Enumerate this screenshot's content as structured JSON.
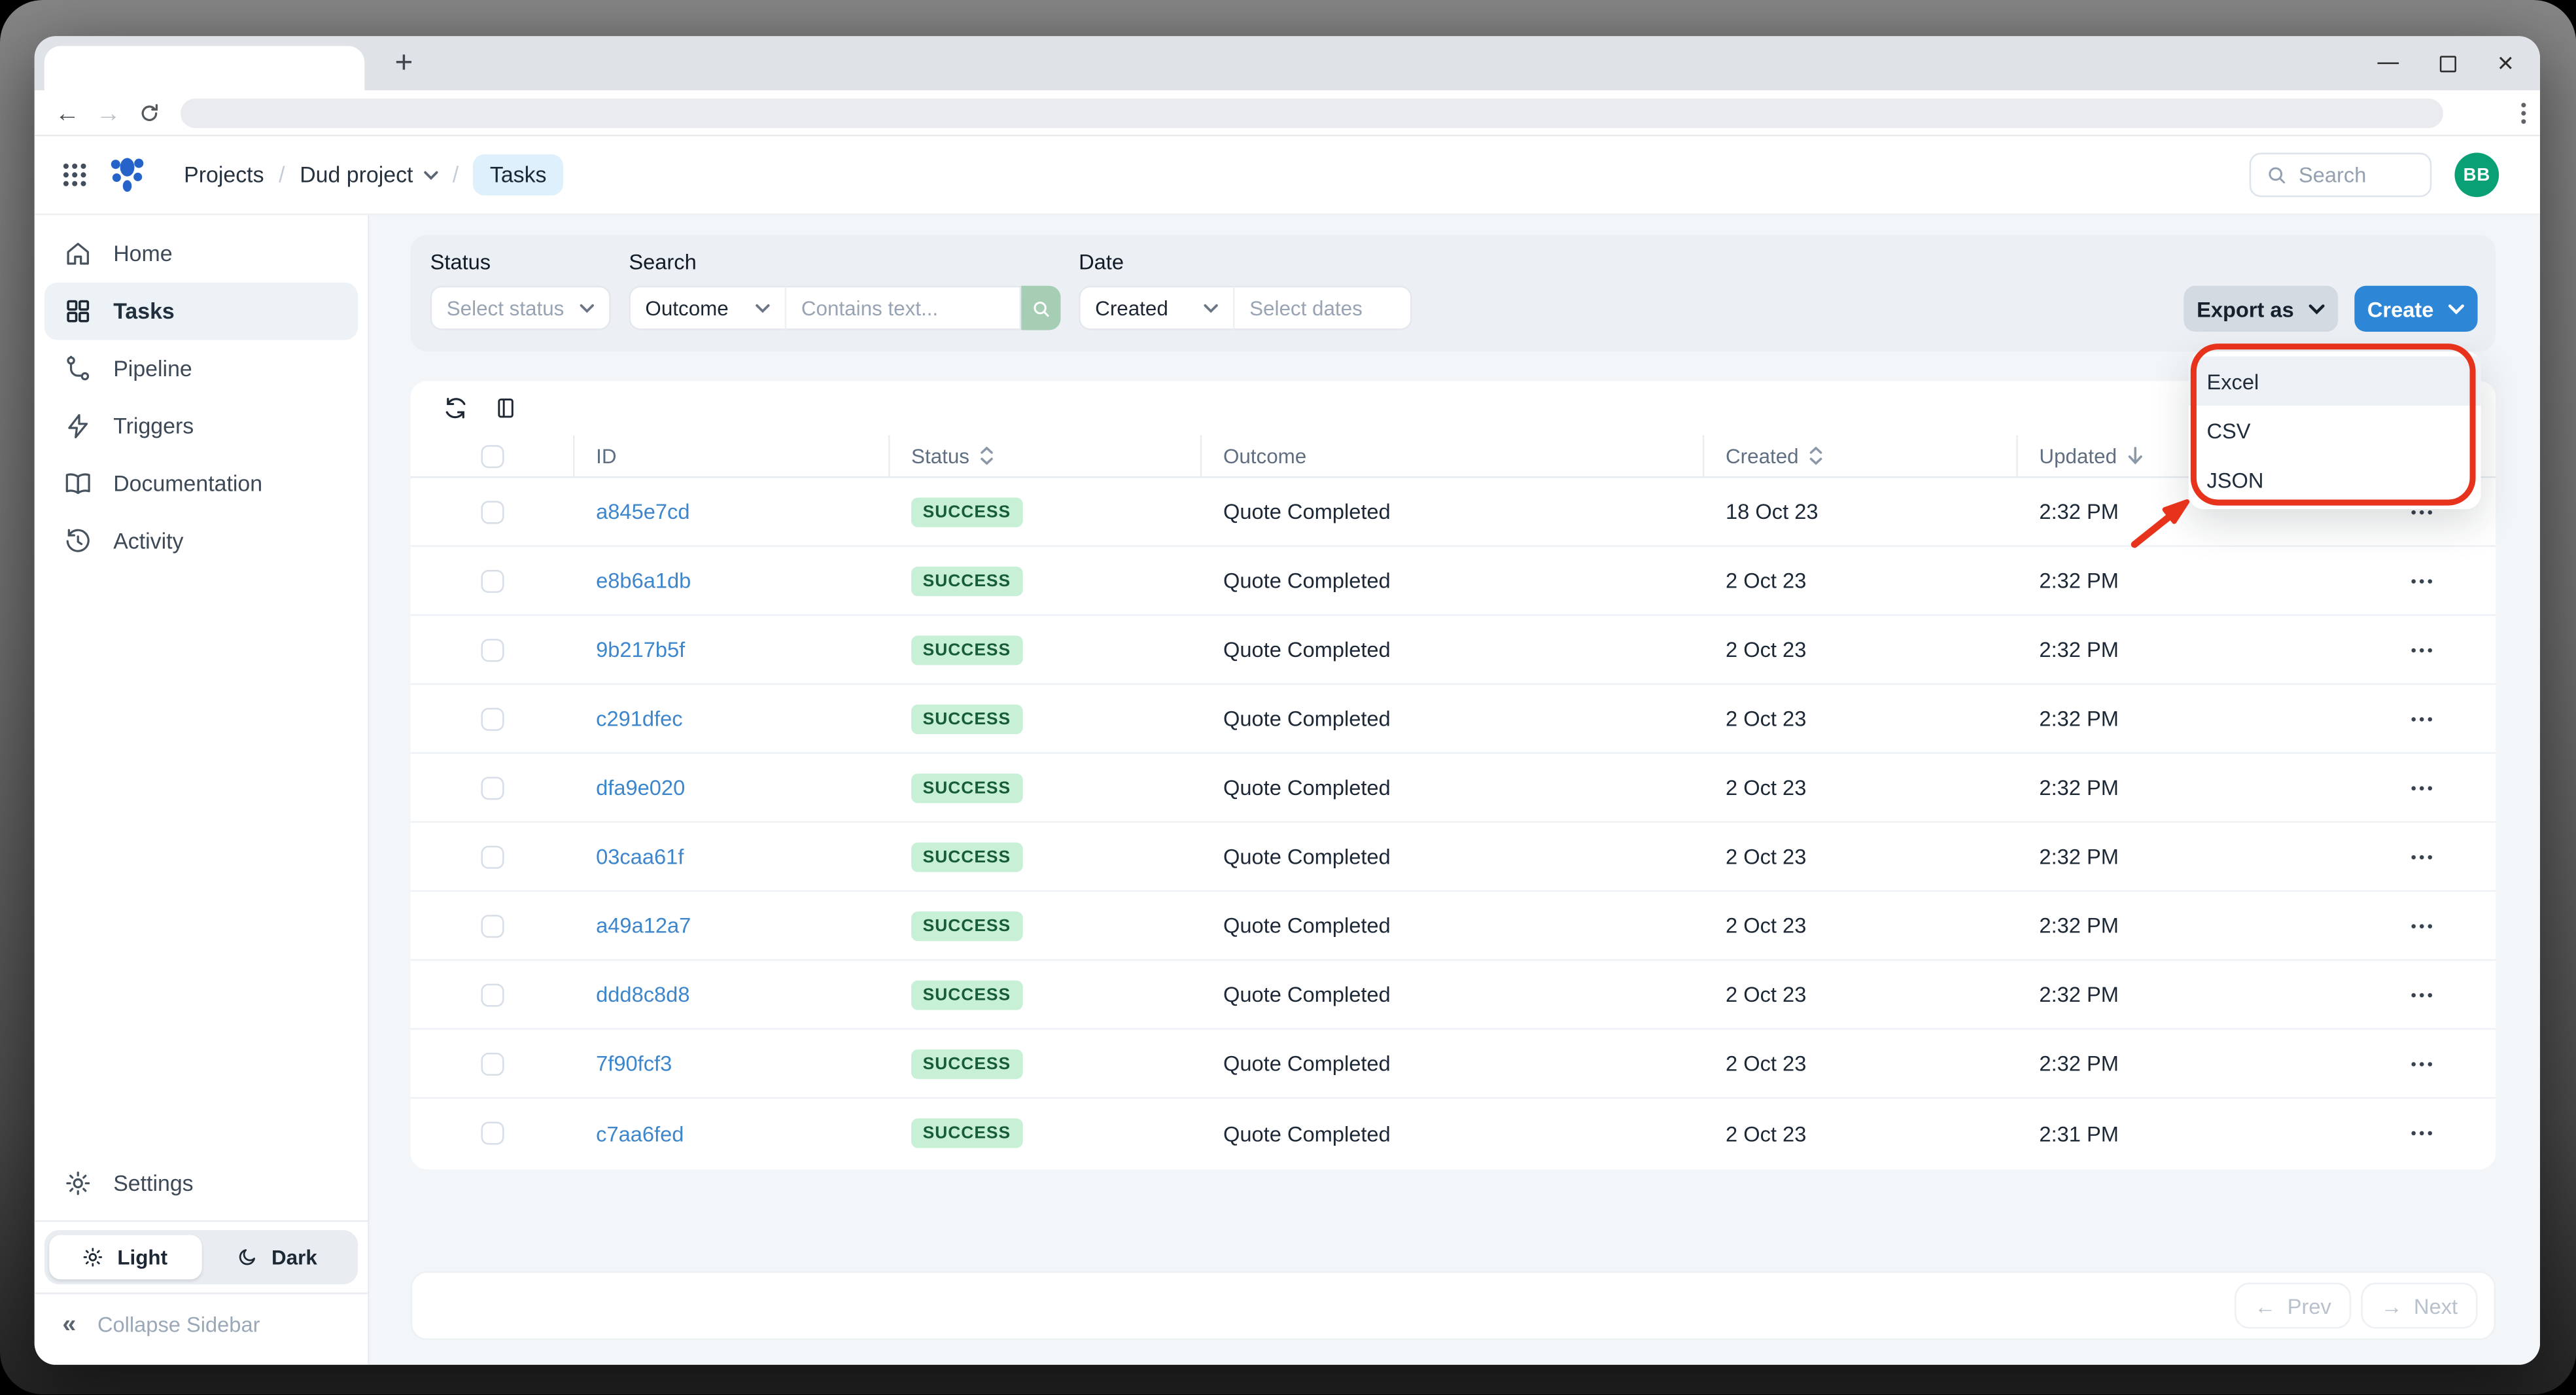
{
  "browser": {
    "tab_title": "",
    "url_value": ""
  },
  "icons": {
    "new-tab-icon": "+",
    "close-icon": "×",
    "back-icon": "←",
    "forward-icon": "→",
    "collapse-icon": "«",
    "prev-arrow-icon": "←",
    "next-arrow-icon": "→"
  },
  "header": {
    "breadcrumb": {
      "projects": "Projects",
      "separator": "/",
      "project": "Dud project",
      "current": "Tasks"
    },
    "search_placeholder": "Search",
    "avatar_initials": "BB"
  },
  "sidebar": {
    "items": [
      {
        "label": "Home",
        "active": false
      },
      {
        "label": "Tasks",
        "active": true
      },
      {
        "label": "Pipeline",
        "active": false
      },
      {
        "label": "Triggers",
        "active": false
      },
      {
        "label": "Documentation",
        "active": false
      },
      {
        "label": "Activity",
        "active": false
      }
    ],
    "settings_label": "Settings",
    "theme": {
      "light_label": "Light",
      "dark_label": "Dark",
      "selected": "Light"
    },
    "collapse_label": "Collapse Sidebar"
  },
  "filters": {
    "status": {
      "label": "Status",
      "placeholder": "Select status"
    },
    "search": {
      "label": "Search",
      "field": "Outcome",
      "placeholder": "Contains text..."
    },
    "date": {
      "label": "Date",
      "field": "Created",
      "placeholder": "Select dates"
    }
  },
  "actions": {
    "export_label": "Export as",
    "create_label": "Create"
  },
  "export_menu": {
    "options": [
      {
        "label": "Excel",
        "highlighted": true
      },
      {
        "label": "CSV",
        "highlighted": false
      },
      {
        "label": "JSON",
        "highlighted": false
      }
    ]
  },
  "table": {
    "columns": [
      {
        "label": "ID",
        "sort": "none"
      },
      {
        "label": "Status",
        "sort": "both"
      },
      {
        "label": "Outcome",
        "sort": "none"
      },
      {
        "label": "Created",
        "sort": "both"
      },
      {
        "label": "Updated",
        "sort": "desc"
      }
    ],
    "rows": [
      {
        "id": "a845e7cd",
        "status": "SUCCESS",
        "outcome": "Quote Completed",
        "created": "18 Oct 23",
        "updated": "2:32 PM"
      },
      {
        "id": "e8b6a1db",
        "status": "SUCCESS",
        "outcome": "Quote Completed",
        "created": "2 Oct 23",
        "updated": "2:32 PM"
      },
      {
        "id": "9b217b5f",
        "status": "SUCCESS",
        "outcome": "Quote Completed",
        "created": "2 Oct 23",
        "updated": "2:32 PM"
      },
      {
        "id": "c291dfec",
        "status": "SUCCESS",
        "outcome": "Quote Completed",
        "created": "2 Oct 23",
        "updated": "2:32 PM"
      },
      {
        "id": "dfa9e020",
        "status": "SUCCESS",
        "outcome": "Quote Completed",
        "created": "2 Oct 23",
        "updated": "2:32 PM"
      },
      {
        "id": "03caa61f",
        "status": "SUCCESS",
        "outcome": "Quote Completed",
        "created": "2 Oct 23",
        "updated": "2:32 PM"
      },
      {
        "id": "a49a12a7",
        "status": "SUCCESS",
        "outcome": "Quote Completed",
        "created": "2 Oct 23",
        "updated": "2:32 PM"
      },
      {
        "id": "ddd8c8d8",
        "status": "SUCCESS",
        "outcome": "Quote Completed",
        "created": "2 Oct 23",
        "updated": "2:32 PM"
      },
      {
        "id": "7f90fcf3",
        "status": "SUCCESS",
        "outcome": "Quote Completed",
        "created": "2 Oct 23",
        "updated": "2:32 PM"
      },
      {
        "id": "c7aa6fed",
        "status": "SUCCESS",
        "outcome": "Quote Completed",
        "created": "2 Oct 23",
        "updated": "2:31 PM"
      }
    ]
  },
  "pagination": {
    "prev_label": "Prev",
    "next_label": "Next"
  },
  "colors": {
    "accent_blue": "#2e86d7",
    "export_button_bg": "#d3dae1",
    "success_badge_bg": "#c7f0d6",
    "success_badge_text": "#175c38",
    "link_blue": "#3e86cc",
    "avatar_green": "#0aa076",
    "search_button_green": "#a5ceb4",
    "annotation_red": "#e8331c",
    "breadcrumb_chip_bg": "#def0fb",
    "content_bg": "#f3f6f9",
    "filter_panel_bg": "#ecf0f4"
  }
}
